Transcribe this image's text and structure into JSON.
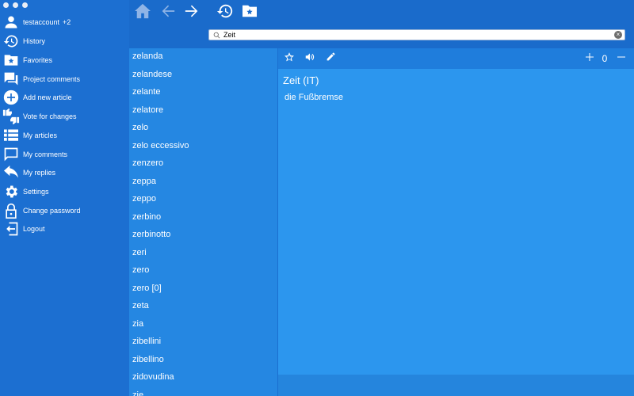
{
  "sidebar": {
    "account": {
      "name": "testaccount",
      "extra": "+2"
    },
    "items": [
      {
        "label": "History",
        "icon": "history-icon"
      },
      {
        "label": "Favorites",
        "icon": "favorites-folder-icon"
      },
      {
        "label": "Project comments",
        "icon": "comments-icon"
      },
      {
        "label": "Add new article",
        "icon": "add-icon"
      },
      {
        "label": "Vote for changes",
        "icon": "vote-icon"
      },
      {
        "label": "My articles",
        "icon": "list-icon"
      },
      {
        "label": "My comments",
        "icon": "comment-icon"
      },
      {
        "label": "My replies",
        "icon": "reply-icon"
      },
      {
        "label": "Settings",
        "icon": "gear-icon"
      },
      {
        "label": "Change password",
        "icon": "lock-icon"
      },
      {
        "label": "Logout",
        "icon": "logout-icon"
      }
    ]
  },
  "search": {
    "value": "Zeit",
    "placeholder": ""
  },
  "wordlist": [
    "zelanda",
    "zelandese",
    "zelante",
    "zelatore",
    "zelo",
    "zelo eccessivo",
    "zenzero",
    "zeppa",
    "zeppo",
    "zerbino",
    "zerbinotto",
    "zeri",
    "zero",
    "zero [0]",
    "zeta",
    "zia",
    "zibellini",
    "zibellino",
    "zidovudina",
    "zie"
  ],
  "entry": {
    "title": "Zeit (IT)",
    "translation": "die Fußbremse",
    "vote_count": "0"
  },
  "colors": {
    "sidebar": "#1c6fd1",
    "list": "#2587e2",
    "detail": "#2c96ee"
  }
}
